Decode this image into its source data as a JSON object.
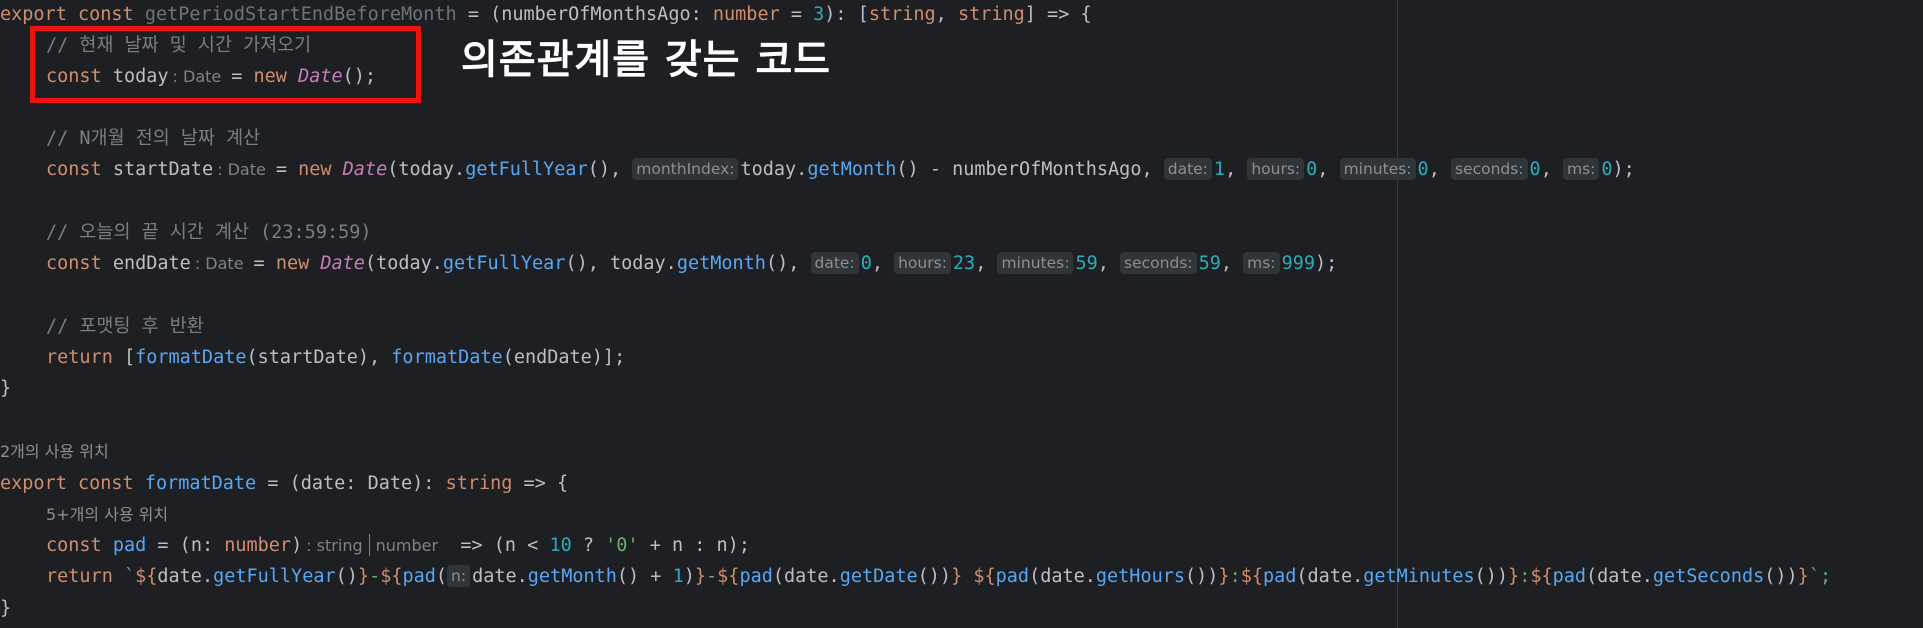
{
  "code": {
    "l1": {
      "kw1": "export",
      "kw2": "const",
      "fn": "getPeriodStartEndBeforeMonth",
      "eq": " = (",
      "param": "numberOfMonthsAgo",
      "colon": ": ",
      "ptype": "number",
      "assign": " = ",
      "default": "3",
      "ret1": "): [",
      "rtype1": "string",
      "comma": ", ",
      "rtype2": "string",
      "ret2": "] => {"
    },
    "l2": {
      "comment": "// 현재 날짜 및 시간 가져오기"
    },
    "l3": {
      "kw": "const",
      "var": " today",
      "type_hint": ": Date",
      "eq": "= ",
      "new": "new",
      "cls": "Date",
      "rest": "();"
    },
    "l5": {
      "comment": "// N개월 전의 날짜 계산"
    },
    "l6": {
      "kw": "const",
      "var": " startDate",
      "type_hint": ": Date",
      "eq": "= ",
      "new": "new",
      "cls": "Date",
      "p1": "(today.",
      "m1": "getFullYear",
      "p2": "(), ",
      "h1": "monthIndex:",
      "p3": "today.",
      "m2": "getMonth",
      "p4": "() - numberOfMonthsAgo, ",
      "h2": "date:",
      "v2": "1",
      "c2": ", ",
      "h3": "hours:",
      "v3": "0",
      "c3": ", ",
      "h4": "minutes:",
      "v4": "0",
      "c4": ", ",
      "h5": "seconds:",
      "v5": "0",
      "c5": ", ",
      "h6": "ms:",
      "v6": "0",
      "end": ");"
    },
    "l8": {
      "comment": "// 오늘의 끝 시간 계산 (23:59:59)"
    },
    "l9": {
      "kw": "const",
      "var": " endDate",
      "type_hint": ": Date",
      "eq": "= ",
      "new": "new",
      "cls": "Date",
      "p1": "(today.",
      "m1": "getFullYear",
      "p2": "(), today.",
      "m2": "getMonth",
      "p3": "(), ",
      "h1": "date:",
      "v1": "0",
      "c1": ", ",
      "h2": "hours:",
      "v2": "23",
      "c2": ", ",
      "h3": "minutes:",
      "v3": "59",
      "c3": ", ",
      "h4": "seconds:",
      "v4": "59",
      "c4": ", ",
      "h5": "ms:",
      "v5": "999",
      "end": ");"
    },
    "l11": {
      "comment": "// 포맷팅 후 반환"
    },
    "l12": {
      "kw": "return",
      "p1": " [",
      "f1": "formatDate",
      "p2": "(startDate), ",
      "f2": "formatDate",
      "p3": "(endDate)];"
    },
    "l13": {
      "brace": "}"
    },
    "usage1": "2개의 사용 위치",
    "l16": {
      "kw1": "export",
      "kw2": "const",
      "fn": "formatDate",
      "p1": " = (date: Date): ",
      "type": "string",
      "p2": " => {"
    },
    "usage2": "5+개의 사용 위치",
    "l18": {
      "kw": "const",
      "fn": "pad",
      "p1": " = (n: ",
      "type": "number",
      "p2": ")",
      "th1": ": string",
      "th2": "number",
      "p3": "=> (n < ",
      "n1": "10",
      "p4": " ? ",
      "s1": "'0'",
      "p5": " + n : n);"
    },
    "l19": {
      "kw": "return",
      "bt": " `",
      "d1": "${",
      "a1": "date.",
      "m1": "getFullYear",
      "a2": "()",
      "e1": "}",
      "sep1": "-",
      "d2": "${",
      "f2": "pad",
      "a3": "(",
      "h": "n:",
      "a4": "date.",
      "m2": "getMonth",
      "a5": "() + ",
      "n1": "1",
      "a6": ")",
      "e2": "}",
      "sep2": "-",
      "d3": "${",
      "f3": "pad",
      "a7": "(date.",
      "m3": "getDate",
      "a8": "())",
      "e3": "}",
      "sep3": " ",
      "d4": "${",
      "f4": "pad",
      "a9": "(date.",
      "m4": "getHours",
      "a10": "())",
      "e4": "}",
      "sep4": ":",
      "d5": "${",
      "f5": "pad",
      "a11": "(date.",
      "m5": "getMinutes",
      "a12": "())",
      "e5": "}",
      "sep5": ":",
      "d6": "${",
      "f6": "pad",
      "a13": "(date.",
      "m6": "getSeconds",
      "a14": "())",
      "e6": "}",
      "end": "`;"
    },
    "l20": {
      "brace": "}"
    }
  },
  "annotation": {
    "text": "의존관계를 갖는 코드",
    "box_color": "#ee1111"
  },
  "colors": {
    "background": "#1e1f22",
    "keyword": "#cf8e6d",
    "function": "#56a8f5",
    "number": "#2aacb8",
    "comment": "#7a7e85",
    "class": "#c77dbb",
    "string": "#6aab73"
  }
}
